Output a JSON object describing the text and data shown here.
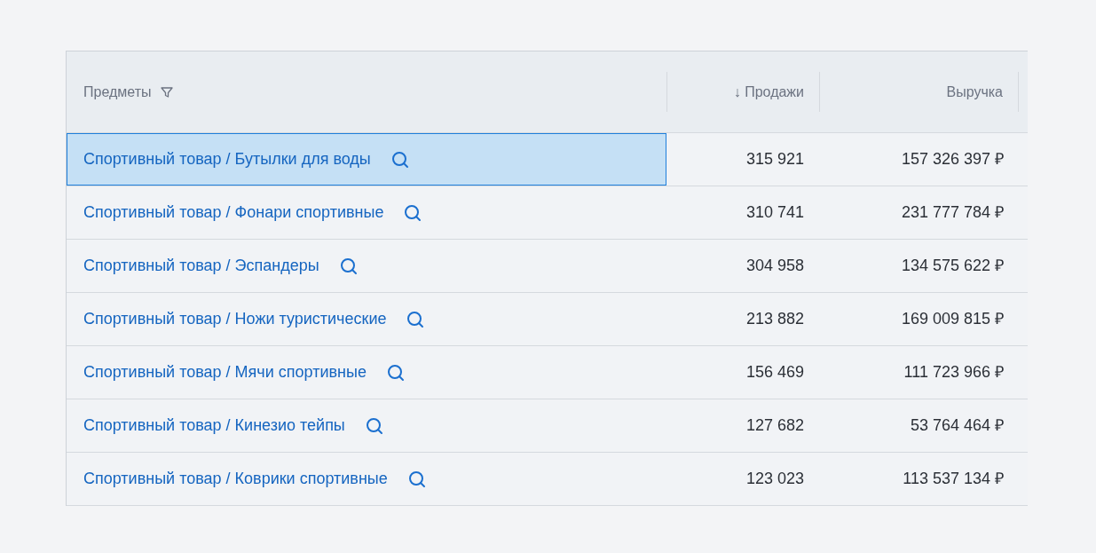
{
  "table": {
    "columns": [
      {
        "label": "Предметы",
        "kind": "filter"
      },
      {
        "label": "↓ Продажи",
        "kind": "plain"
      },
      {
        "label": "Выручка",
        "kind": "plain"
      }
    ],
    "rows": [
      {
        "item": "Спортивный товар / Бутылки для воды",
        "sales": "315 921",
        "revenue": "157 326 397 ₽",
        "selected": true
      },
      {
        "item": "Спортивный товар / Фонари спортивные",
        "sales": "310 741",
        "revenue": "231 777 784 ₽",
        "selected": false
      },
      {
        "item": "Спортивный товар / Эспандеры",
        "sales": "304 958",
        "revenue": "134 575 622 ₽",
        "selected": false
      },
      {
        "item": "Спортивный товар / Ножи туристические",
        "sales": "213 882",
        "revenue": "169 009 815 ₽",
        "selected": false
      },
      {
        "item": "Спортивный товар / Мячи спортивные",
        "sales": "156 469",
        "revenue": "111 723 966 ₽",
        "selected": false
      },
      {
        "item": "Спортивный товар / Кинезио тейпы",
        "sales": "127 682",
        "revenue": "53 764 464 ₽",
        "selected": false
      },
      {
        "item": "Спортивный товар / Коврики спортивные",
        "sales": "123 023",
        "revenue": "113 537 134 ₽",
        "selected": false
      }
    ]
  }
}
